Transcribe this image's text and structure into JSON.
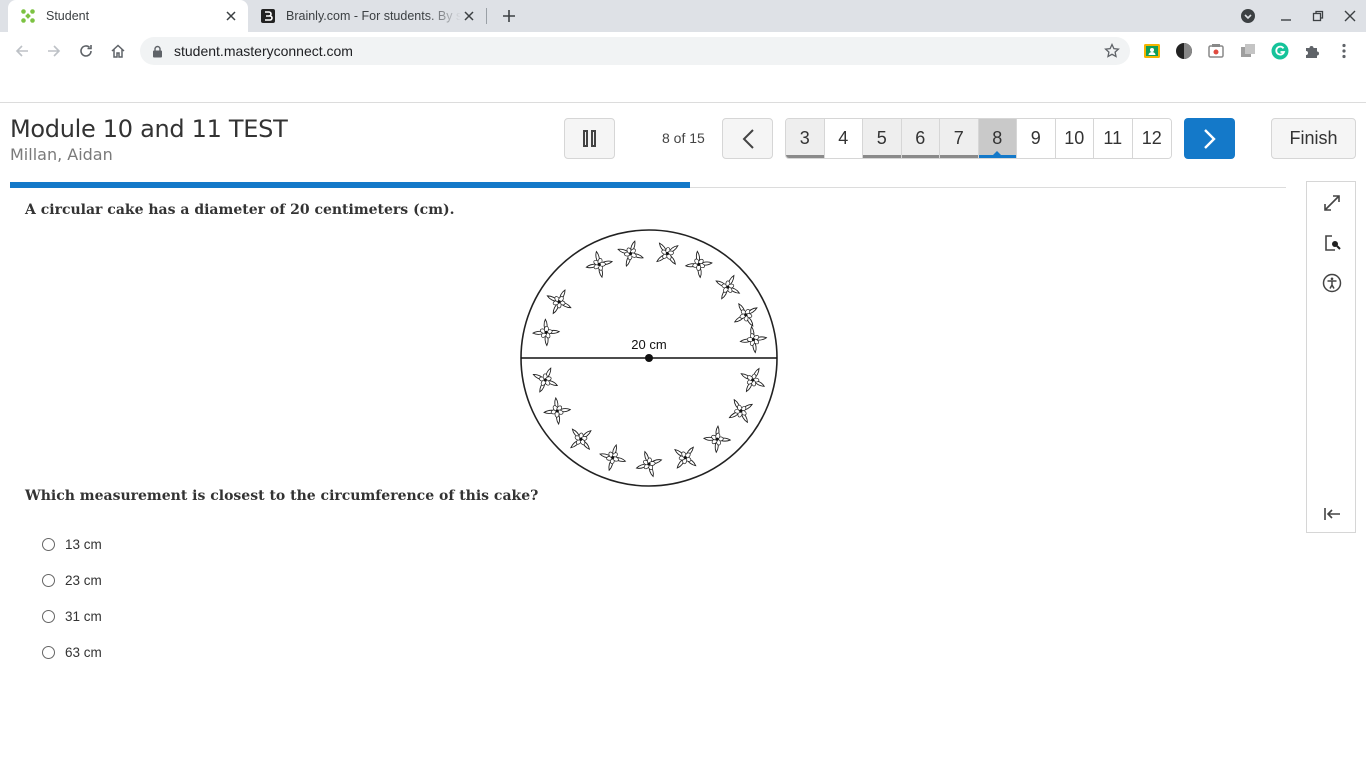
{
  "browser": {
    "tabs": [
      {
        "title": "Student",
        "active": true
      },
      {
        "title": "Brainly.com - For students. By students.",
        "active": false
      }
    ],
    "url": "student.masteryconnect.com"
  },
  "header": {
    "test_title": "Module 10 and 11 TEST",
    "student_name": "Millan, Aidan",
    "progress_text": "8 of 15",
    "finish_label": "Finish"
  },
  "question_nav": {
    "numbers": [
      "3",
      "4",
      "5",
      "6",
      "7",
      "8",
      "9",
      "10",
      "11",
      "12"
    ],
    "answered": [
      "3",
      "5",
      "6",
      "7"
    ],
    "current": "8"
  },
  "progress": {
    "fraction": 0.5333
  },
  "question": {
    "stem": "A circular cake has a diameter of 20 centimeters (cm).",
    "diagram_label": "20 cm",
    "prompt": "Which measurement is closest to the circumference of this cake?",
    "choices": [
      "13 cm",
      "23 cm",
      "31 cm",
      "63 cm"
    ]
  },
  "icons": {
    "side_tools": [
      "expand-icon",
      "magnifier-icon",
      "accessibility-icon",
      "collapse-panel-icon"
    ]
  },
  "colors": {
    "accent": "#1479c9"
  }
}
